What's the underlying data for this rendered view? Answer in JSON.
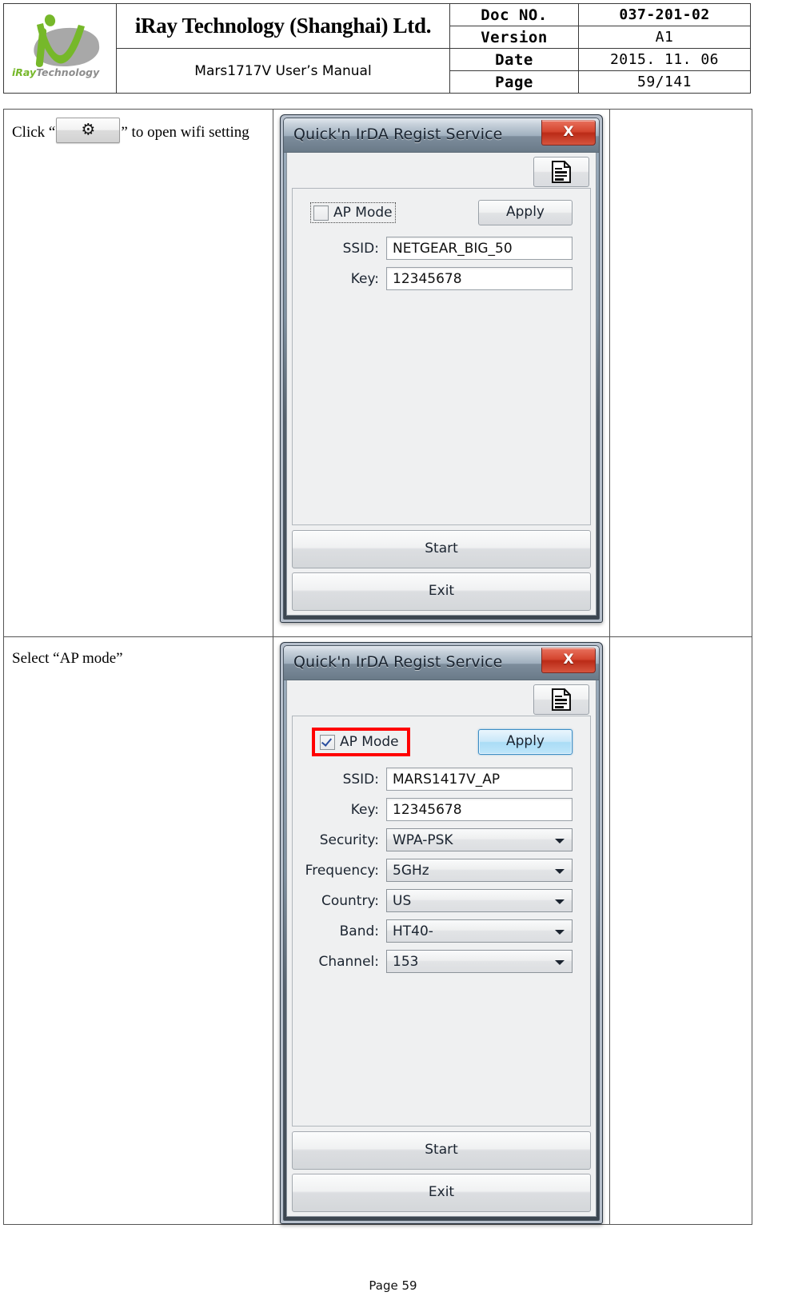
{
  "header": {
    "company": "iRay Technology (Shanghai) Ltd.",
    "manual": "Mars1717V User’s Manual",
    "logo_text_green": "iRay",
    "logo_text_gray": "Technology",
    "fields": [
      {
        "label": "Doc NO.",
        "value": "037-201-02"
      },
      {
        "label": "Version",
        "value": "A1"
      },
      {
        "label": "Date",
        "value": "2015. 11. 06"
      },
      {
        "label": "Page",
        "value": "59/141"
      }
    ]
  },
  "steps": [
    {
      "text_before": "Click “",
      "button_icon": "gear-icon",
      "text_after": "” to open wifi setting"
    },
    {
      "text": "Select “AP mode”"
    }
  ],
  "dialog1": {
    "title": "Quick'n IrDA Regist Service",
    "close_label": "X",
    "doc_button_icon": "document-icon",
    "ap_mode_label": "AP Mode",
    "ap_mode_checked": false,
    "apply_label": "Apply",
    "fields": [
      {
        "label": "SSID:",
        "value": "NETGEAR_BIG_50",
        "type": "text"
      },
      {
        "label": "Key:",
        "value": "12345678",
        "type": "text"
      }
    ],
    "start_label": "Start",
    "exit_label": "Exit"
  },
  "dialog2": {
    "title": "Quick'n IrDA Regist Service",
    "close_label": "X",
    "doc_button_icon": "document-icon",
    "ap_mode_label": "AP Mode",
    "ap_mode_checked": true,
    "apply_label": "Apply",
    "highlight_color": "#ff0000",
    "fields": [
      {
        "label": "SSID:",
        "value": "MARS1417V_AP",
        "type": "text"
      },
      {
        "label": "Key:",
        "value": "12345678",
        "type": "text"
      },
      {
        "label": "Security:",
        "value": "WPA-PSK",
        "type": "combo"
      },
      {
        "label": "Frequency:",
        "value": "5GHz",
        "type": "combo"
      },
      {
        "label": "Country:",
        "value": "US",
        "type": "combo"
      },
      {
        "label": "Band:",
        "value": "HT40-",
        "type": "combo"
      },
      {
        "label": "Channel:",
        "value": "153",
        "type": "combo"
      }
    ],
    "start_label": "Start",
    "exit_label": "Exit"
  },
  "footer": {
    "page": "Page 59"
  }
}
